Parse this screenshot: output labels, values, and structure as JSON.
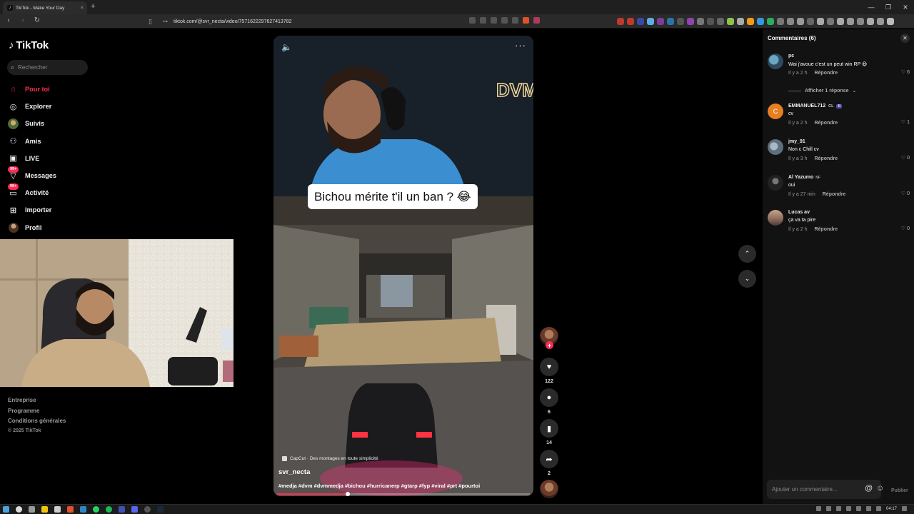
{
  "browser": {
    "tab_title": "TikTok - Make Your Day",
    "tab_close": "×",
    "new_tab": "+",
    "url": "tiktok.com/@svr_necta/video/7571622297627413782",
    "window_controls": [
      "—",
      "❐",
      "✕"
    ]
  },
  "sidebar": {
    "logo": "TikTok",
    "search_placeholder": "Rechercher",
    "items": [
      {
        "label": "Pour toi",
        "icon": "home-icon",
        "active": true
      },
      {
        "label": "Explorer",
        "icon": "compass-icon"
      },
      {
        "label": "Suivis",
        "icon": "following-avatar-icon"
      },
      {
        "label": "Amis",
        "icon": "friends-icon"
      },
      {
        "label": "LIVE",
        "icon": "live-icon"
      },
      {
        "label": "Messages",
        "icon": "messages-icon",
        "badge": "99+"
      },
      {
        "label": "Activité",
        "icon": "activity-icon",
        "badge": "99+"
      },
      {
        "label": "Importer",
        "icon": "upload-icon"
      },
      {
        "label": "Profil",
        "icon": "profile-avatar-icon"
      }
    ],
    "footer": [
      "Entreprise",
      "Programme",
      "Conditions générales"
    ],
    "copyright": "© 2025 TikTok"
  },
  "video": {
    "caption_overlay": "Bichou mérite t'il un ban ? 😂",
    "capcut_label": "CapCut · Des montages en toute simplicité",
    "author": "svr_necta",
    "hashtags": "#medja #dvm #dvmmedja #bichou #hurricanerp #gtarp #fyp #viral #prt #pourtoi",
    "progress": 0.28,
    "overlay_logo": "DVM"
  },
  "actions": {
    "likes": "122",
    "comments": "6",
    "saves": "14",
    "shares": "2"
  },
  "comments_panel": {
    "title": "Commentaires (6)",
    "reply_label": "Répondre",
    "view_replies": "Afficher 1 réponse",
    "input_placeholder": "Ajouter un commentaire...",
    "post_label": "Publier",
    "comments": [
      {
        "user": "pc",
        "text": "Wai j'avoue c'est un peut win RP 😆",
        "time": "Il y a 2 h",
        "likes": "6",
        "avatar_color": "#3b6e8f"
      },
      {
        "user": "EMMANUEL712",
        "tag": "CL",
        "text": "cv",
        "time": "Il y a 2 h",
        "likes": "1",
        "avatar_color": "#e67e22",
        "avatar_letter": "C"
      },
      {
        "user": "jmy_91",
        "text": "Non c Chill cv",
        "time": "Il y a 3 h",
        "likes": "0",
        "avatar_color": "#6b7d8c"
      },
      {
        "user": "Al Yazumo",
        "tag_small": "NF",
        "text": "oui",
        "time": "Il y a 27 min",
        "likes": "0",
        "avatar_color": "#444"
      },
      {
        "user": "Lucas av",
        "text": "ça va ta pire",
        "time": "Il y a 2 h",
        "likes": "0",
        "avatar_color": "#9a7a6a"
      }
    ]
  },
  "taskbar": {
    "time": "04:17"
  },
  "colors": {
    "accent": "#fe2c55",
    "background": "#000000",
    "panel": "#121212"
  }
}
